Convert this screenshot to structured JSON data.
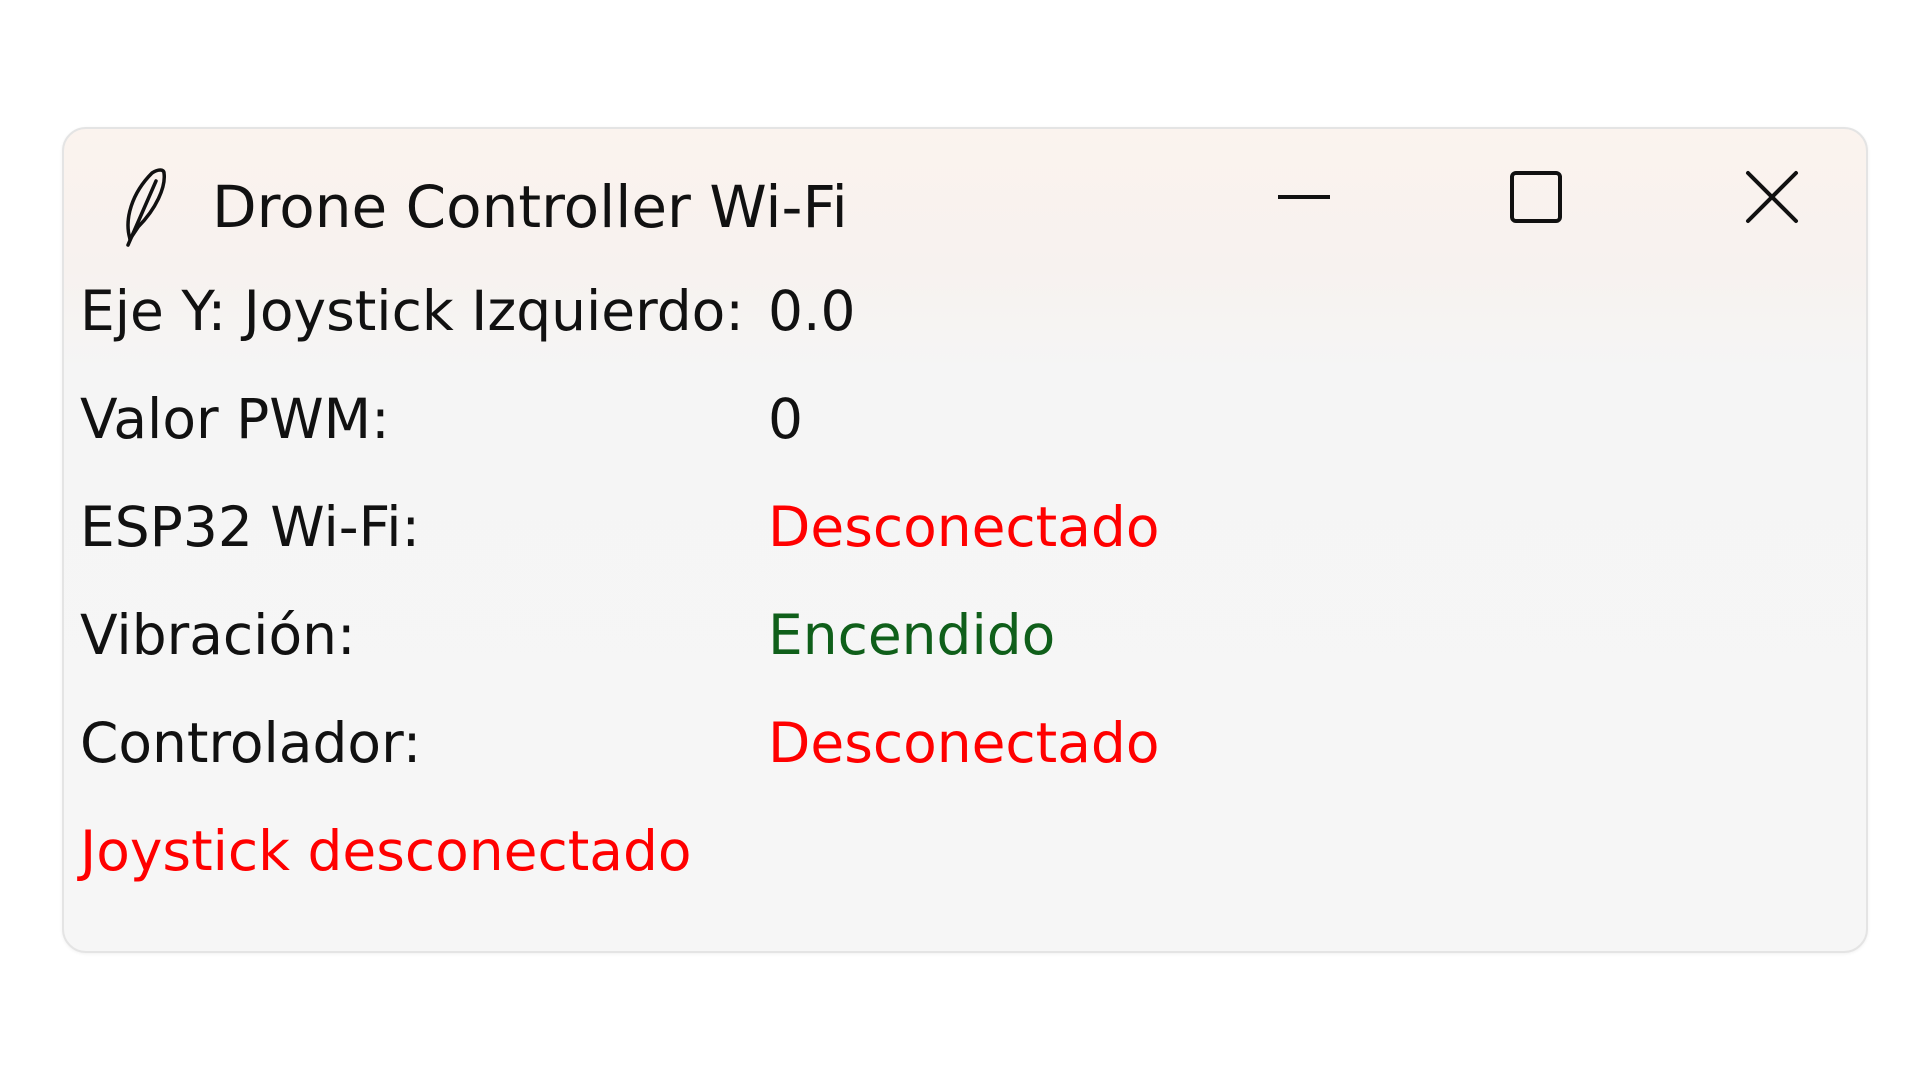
{
  "window": {
    "title": "Drone Controller Wi-Fi",
    "icon": "feather-icon",
    "controls": {
      "minimize_icon": "minimize-icon",
      "maximize_icon": "maximize-icon",
      "close_icon": "close-icon"
    }
  },
  "rows": [
    {
      "label": "Eje Y: Joystick Izquierdo:",
      "value": "0.0",
      "value_color": "#111111"
    },
    {
      "label": "Valor PWM:",
      "value": "0",
      "value_color": "#111111"
    },
    {
      "label": "ESP32 Wi-Fi:",
      "value": "Desconectado",
      "value_color": "#ff0000"
    },
    {
      "label": "Vibración:",
      "value": "Encendido",
      "value_color": "#0f5f1a"
    },
    {
      "label": "Controlador:",
      "value": "Desconectado",
      "value_color": "#ff0000"
    }
  ],
  "status_message": {
    "text": "Joystick desconectado",
    "color": "#ff0000"
  }
}
